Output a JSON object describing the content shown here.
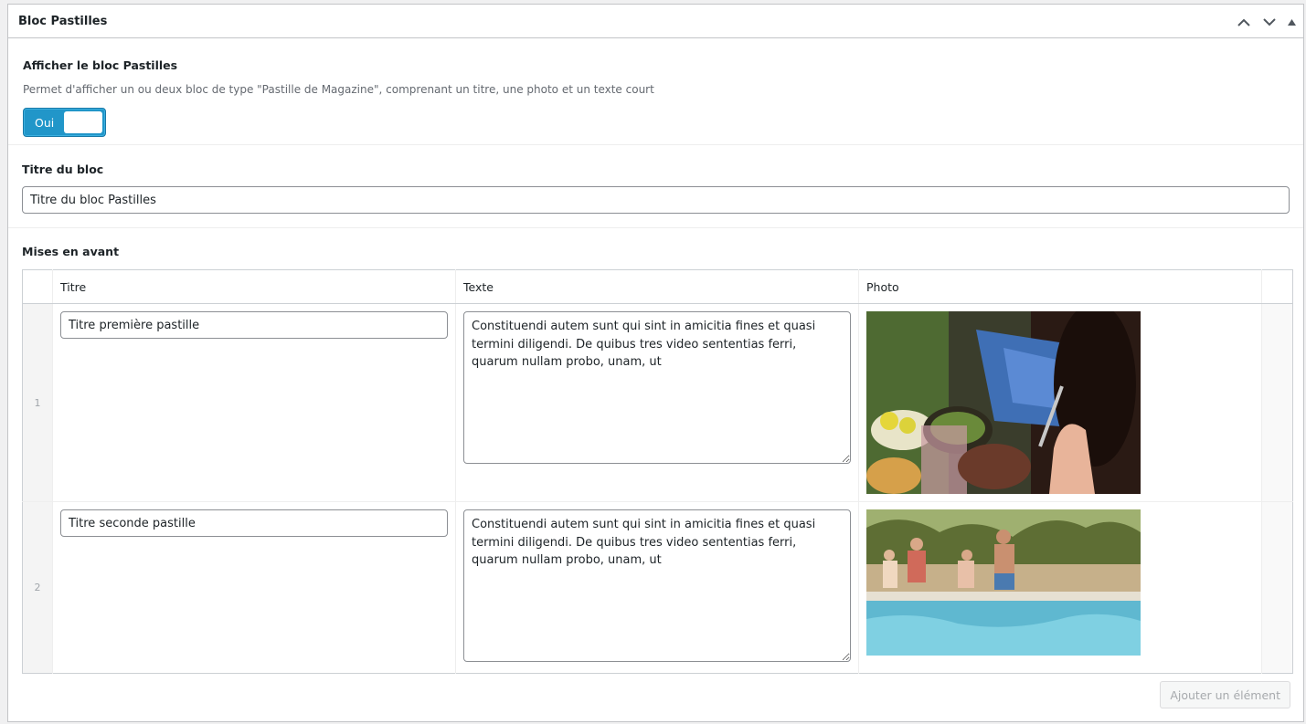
{
  "postbox": {
    "title": "Bloc Pastilles"
  },
  "fields": {
    "afficher": {
      "label": "Afficher le bloc Pastilles",
      "description": "Permet d'afficher un ou deux bloc de type \"Pastille de Magazine\", comprenant un titre, une photo et un texte court",
      "toggle_label": "Oui",
      "toggle_on": true
    },
    "titre_bloc": {
      "label": "Titre du bloc",
      "value": "Titre du bloc Pastilles"
    },
    "mises_en_avant": {
      "label": "Mises en avant",
      "columns": [
        "Titre",
        "Texte",
        "Photo"
      ],
      "rows": [
        {
          "index": "1",
          "titre": "Titre première pastille",
          "texte": "Constituendi autem sunt qui sint in amicitia fines et quasi termini diligendi. De quibus tres video sententias ferri, quarum nullam probo, unam, ut",
          "photo": "friends dining at outdoor table"
        },
        {
          "index": "2",
          "titre": "Titre seconde pastille",
          "texte": "Constituendi autem sunt qui sint in amicitia fines et quasi termini diligendi. De quibus tres video sententias ferri, quarum nullam probo, unam, ut",
          "photo": "family at swimming pool"
        }
      ],
      "add_button": "Ajouter un élément"
    }
  },
  "colors": {
    "toggle_bg": "#2196c9",
    "border": "#c3c4c7"
  }
}
